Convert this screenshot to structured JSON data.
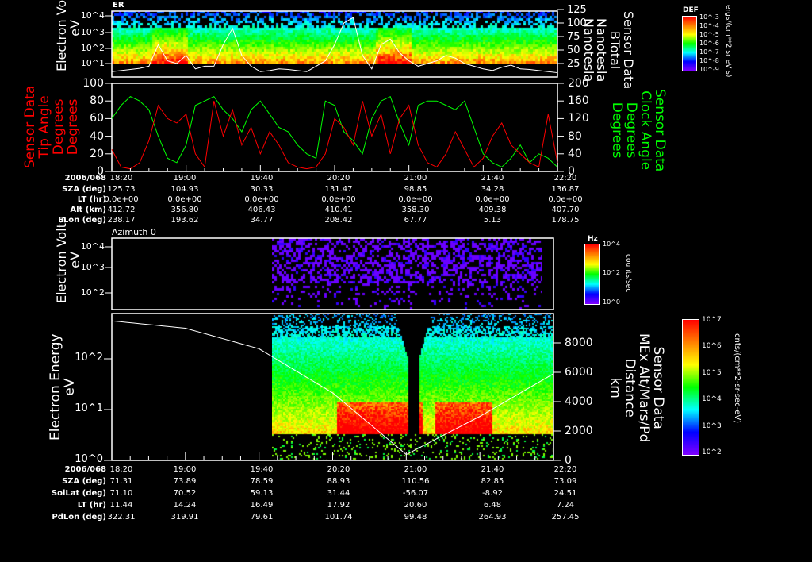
{
  "panel1": {
    "title": "ER",
    "ylabel": [
      "Electron Volts",
      "eV"
    ],
    "yticks": [
      "10^1",
      "10^2",
      "10^3",
      "10^4"
    ],
    "right_ticks": [
      "25",
      "50",
      "75",
      "100",
      "125"
    ],
    "right_label": [
      "Sensor Data",
      "BTotal",
      "Nanotesla",
      "Nanotesla"
    ],
    "colorbar": {
      "title": "DEF",
      "ticks": [
        "10^-9",
        "10^-8",
        "10^-7",
        "10^-6",
        "10^-5",
        "10^-4",
        "10^-3"
      ],
      "unit": "ergs/(cm**2 sr eV s)"
    }
  },
  "panel2": {
    "left_ticks": [
      "0",
      "20",
      "40",
      "60",
      "80",
      "100"
    ],
    "right_ticks": [
      "0",
      "40",
      "80",
      "120",
      "160",
      "200"
    ],
    "left_label": [
      "Sensor Data",
      "Tip Angle",
      "Degrees",
      "Degrees"
    ],
    "right_label": [
      "Sensor Data",
      "Clock Angle",
      "Degrees",
      "Degrees"
    ],
    "colors": {
      "tip": "#ff0000",
      "clock": "#00ff00"
    }
  },
  "ephem1": {
    "row_labels": [
      "2006/068",
      "SZA (deg)",
      "LT (hr)",
      "Alt (km)",
      "ELon (deg)"
    ],
    "columns": [
      [
        "18:20",
        "125.73",
        "0.0e+00",
        "412.72",
        "238.17"
      ],
      [
        "19:00",
        "104.93",
        "0.0e+00",
        "356.80",
        "193.62"
      ],
      [
        "19:40",
        "30.33",
        "0.0e+00",
        "406.43",
        "34.77"
      ],
      [
        "20:20",
        "131.47",
        "0.0e+00",
        "410.41",
        "208.42"
      ],
      [
        "21:00",
        "98.85",
        "0.0e+00",
        "358.30",
        "67.77"
      ],
      [
        "21:40",
        "34.28",
        "0.0e+00",
        "409.38",
        "5.13"
      ],
      [
        "22:20",
        "136.87",
        "0.0e+00",
        "407.70",
        "178.75"
      ]
    ]
  },
  "panel3": {
    "title": "Azimuth 0",
    "ylabel": [
      "Electron Volts",
      "eV"
    ],
    "yticks": [
      "10^2",
      "10^3",
      "10^4"
    ],
    "colorbar": {
      "title": "Hz",
      "ticks": [
        "10^0",
        "10^2",
        "10^4"
      ],
      "unit": "counts/sec"
    }
  },
  "panel4": {
    "ylabel": [
      "Electron Energy",
      "eV"
    ],
    "yticks": [
      "10^0",
      "10^1",
      "10^2"
    ],
    "right_ticks": [
      "0",
      "2000",
      "4000",
      "6000",
      "8000"
    ],
    "right_label": [
      "Sensor Data",
      "MEx Alt/Mars/Pd",
      "Distance",
      "km"
    ],
    "colorbar": {
      "ticks": [
        "10^2",
        "10^3",
        "10^4",
        "10^5",
        "10^6",
        "10^7"
      ],
      "unit": "cnts/(cm**2-sr-sec-eV)"
    }
  },
  "ephem2": {
    "row_labels": [
      "2006/068",
      "SZA (deg)",
      "SolLat (deg)",
      "LT (hr)",
      "PdLon (deg)"
    ],
    "columns": [
      [
        "18:20",
        "71.31",
        "71.10",
        "11.44",
        "322.31"
      ],
      [
        "19:00",
        "73.89",
        "70.52",
        "14.24",
        "319.91"
      ],
      [
        "19:40",
        "78.59",
        "59.13",
        "16.49",
        "79.61"
      ],
      [
        "20:20",
        "88.93",
        "31.44",
        "17.92",
        "101.74"
      ],
      [
        "21:00",
        "110.56",
        "-56.07",
        "20.60",
        "99.48"
      ],
      [
        "21:40",
        "82.85",
        "-8.92",
        "6.48",
        "264.93"
      ],
      [
        "22:20",
        "73.09",
        "24.51",
        "7.24",
        "257.45"
      ]
    ]
  },
  "chart_data": [
    {
      "type": "heatmap",
      "title": "ER",
      "xlabel": "2006/068",
      "x_range_minutes_from_1820": [
        0,
        240
      ],
      "ylabel": "Electron Volts eV",
      "ylim": [
        3,
        20000
      ],
      "yscale": "log",
      "overlay": {
        "name": "BTotal (nT)",
        "ylim": [
          0,
          125
        ],
        "step_minutes": 5,
        "values": [
          10,
          12,
          14,
          16,
          20,
          60,
          30,
          25,
          40,
          15,
          20,
          20,
          60,
          90,
          40,
          20,
          10,
          12,
          15,
          14,
          12,
          10,
          20,
          30,
          60,
          100,
          110,
          40,
          15,
          60,
          70,
          45,
          30,
          20,
          25,
          30,
          40,
          35,
          25,
          20,
          15,
          12,
          18,
          22,
          15,
          14,
          12,
          10,
          8
        ]
      }
    },
    {
      "type": "line",
      "xlabel": "2006/068",
      "step_minutes": 5,
      "series": [
        {
          "name": "Tip Angle (deg)",
          "axis": "left",
          "ylim": [
            0,
            100
          ],
          "values": [
            25,
            5,
            3,
            10,
            35,
            75,
            60,
            55,
            65,
            20,
            5,
            80,
            40,
            70,
            30,
            50,
            20,
            45,
            30,
            10,
            5,
            3,
            5,
            20,
            60,
            50,
            30,
            80,
            40,
            65,
            20,
            60,
            75,
            30,
            10,
            5,
            20,
            45,
            25,
            5,
            15,
            40,
            55,
            30,
            20,
            10,
            5,
            65,
            10
          ]
        },
        {
          "name": "Clock Angle (deg)",
          "axis": "right",
          "ylim": [
            0,
            200
          ],
          "values": [
            120,
            150,
            170,
            160,
            140,
            80,
            30,
            20,
            60,
            150,
            160,
            170,
            140,
            120,
            90,
            140,
            160,
            130,
            100,
            90,
            60,
            40,
            30,
            160,
            150,
            90,
            70,
            40,
            120,
            160,
            170,
            110,
            60,
            150,
            160,
            160,
            150,
            140,
            160,
            100,
            40,
            20,
            10,
            30,
            60,
            20,
            40,
            30,
            10
          ]
        }
      ]
    },
    {
      "type": "heatmap",
      "title": "Azimuth 0",
      "ylabel": "Electron Volts eV",
      "ylim": [
        10,
        30000
      ],
      "yscale": "log",
      "data_start_minutes": 87,
      "data_end_minutes": 232
    },
    {
      "type": "heatmap",
      "ylabel": "Electron Energy eV",
      "ylim": [
        1,
        800
      ],
      "yscale": "log",
      "data_start_minutes": 87,
      "data_end_minutes": 238,
      "overlay": {
        "name": "MEx Alt/Mars/Pd Distance (km)",
        "ylim": [
          0,
          9500
        ],
        "x_minutes": [
          0,
          40,
          80,
          120,
          160,
          200,
          240
        ],
        "values": [
          9500,
          9000,
          7600,
          4600,
          400,
          3000,
          5900
        ]
      }
    }
  ]
}
